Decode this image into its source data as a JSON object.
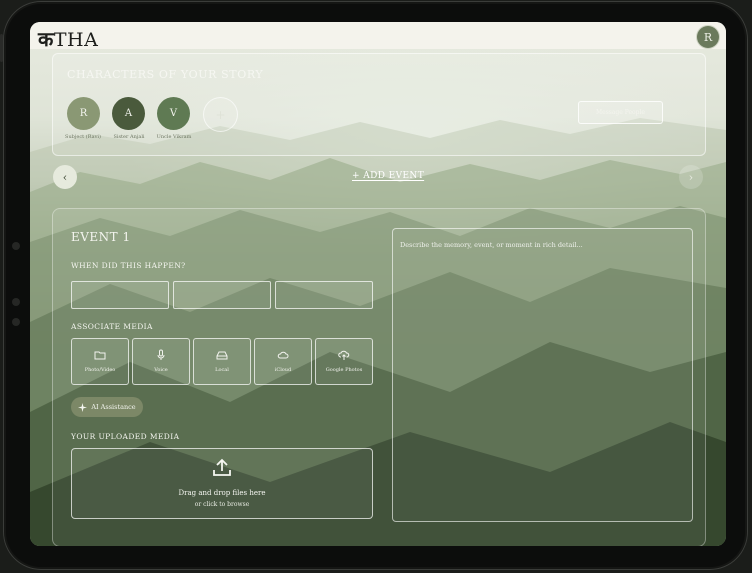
{
  "header": {
    "logo_deva": "क",
    "logo_text": "THA",
    "user_initial": "R"
  },
  "characters": {
    "title": "CHARACTERS OF YOUR STORY",
    "list": [
      {
        "initial": "R",
        "label": "Subject (Ravi)",
        "color": "#8a9874"
      },
      {
        "initial": "A",
        "label": "Sister Anjali",
        "color": "#4a5a3c"
      },
      {
        "initial": "V",
        "label": "Uncle Vikram",
        "color": "#5f7a53"
      }
    ],
    "add_symbol": "+",
    "message_button": "Message People"
  },
  "nav": {
    "prev": "‹",
    "next": "›",
    "add_event": "+ ADD EVENT"
  },
  "event": {
    "title": "EVENT 1",
    "when_label": "WHEN DID THIS HAPPEN?",
    "media_label": "ASSOCIATE MEDIA",
    "media_options": [
      {
        "label": "Photo/Video",
        "icon": "folder-icon"
      },
      {
        "label": "Voice",
        "icon": "microphone-icon"
      },
      {
        "label": "Local",
        "icon": "drive-icon"
      },
      {
        "label": "iCloud",
        "icon": "cloud-icon"
      },
      {
        "label": "Google Photos",
        "icon": "cloud-upload-icon"
      }
    ],
    "ai_button": "AI Assistance",
    "uploaded_label": "YOUR UPLOADED MEDIA",
    "drop_title": "Drag and drop files here",
    "drop_sub": "or click to browse",
    "description_placeholder": "Describe the memory, event, or moment in rich detail..."
  }
}
